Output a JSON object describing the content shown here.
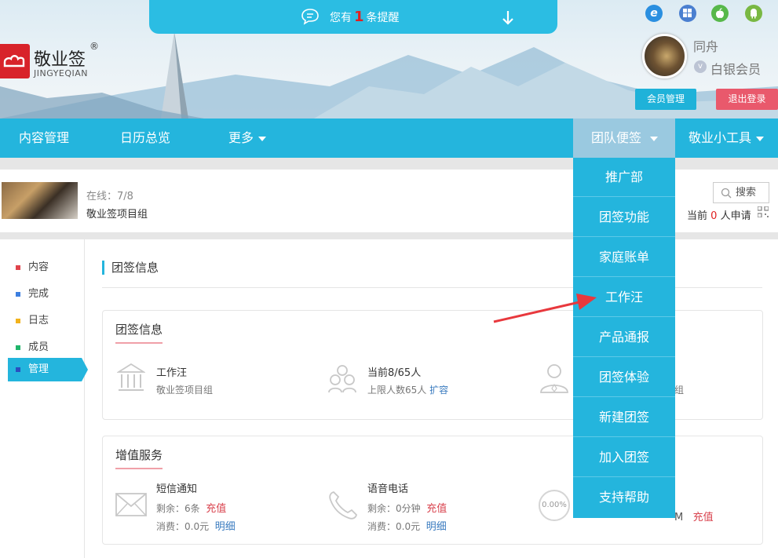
{
  "notification": {
    "prefix": "您有",
    "count": "1",
    "suffix": "条提醒"
  },
  "logo": {
    "name": "敬业签",
    "registered": "®",
    "english": "JINGYEQIAN"
  },
  "platforms": [
    "ie-icon",
    "windows-icon",
    "apple-icon",
    "android-icon"
  ],
  "user": {
    "name": "同舟",
    "badge": "v",
    "level": "白银会员",
    "member_button": "会员管理",
    "logout_button": "退出登录"
  },
  "nav": {
    "items": [
      "内容管理",
      "日历总览",
      "更多"
    ],
    "team": "团队便签",
    "tools": "敬业小工具"
  },
  "group": {
    "online": "在线：7/8",
    "name": "敬业签项目组",
    "search": "搜索",
    "apply_prefix": "当前",
    "apply_count": "0",
    "apply_suffix": "人申请"
  },
  "sidebar": {
    "items": [
      "内容",
      "完成",
      "日志",
      "成员",
      "管理"
    ]
  },
  "section_title": "团签信息",
  "team_card": {
    "title": "团签信息",
    "owner_name": "工作汪",
    "owner_sub": "敬业签项目组",
    "count_name": "当前8/65人",
    "count_sub": "上限人数65人",
    "expand": "扩容",
    "third_sub": "组"
  },
  "service_card": {
    "title": "增值服务",
    "sms": {
      "name": "短信通知",
      "left": "剩余：6条",
      "recharge": "充值",
      "used": "消费：0.0元",
      "detail": "明细"
    },
    "voice": {
      "name": "语音电话",
      "left": "剩余：0分钟",
      "recharge": "充值",
      "used": "消费：0.0元",
      "detail": "明细"
    },
    "storage": {
      "percent": "0.00%",
      "unit": "M",
      "recharge": "充值"
    }
  },
  "dropdown": [
    "推广部",
    "团签功能",
    "家庭账单",
    "工作汪",
    "产品通报",
    "团签体验",
    "新建团签",
    "加入团签",
    "支持帮助"
  ],
  "colors": {
    "primary": "#24b5dd",
    "logout": "#e9596c",
    "alert": "#e02020",
    "recharge": "#d9434e",
    "link": "#3a7bbf",
    "annotation_arrow": "#e8383d"
  }
}
